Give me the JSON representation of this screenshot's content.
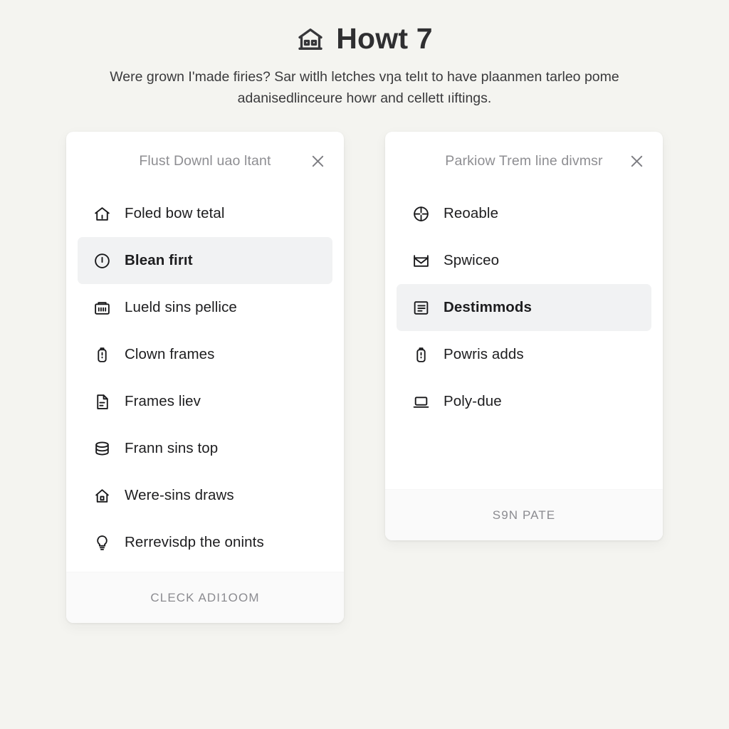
{
  "header": {
    "icon": "bank-building-icon",
    "title": "Howt 7",
    "subtitle": "Were grown I'made firies? Sar witlh letches vŋa telıt to have plaanmen tarleo pome adanisedlinceure howr and cellett ıiftings."
  },
  "cards": [
    {
      "id": "left-panel",
      "header_title": "Flust Downl uao ltant",
      "close_icon": "close-icon",
      "items": [
        {
          "icon": "home-icon",
          "label": "Foled bow tetal",
          "active": false
        },
        {
          "icon": "info-circle-icon",
          "label": "Blean firıt",
          "active": true
        },
        {
          "icon": "briefcase-icon",
          "label": "Lueld sins pellice",
          "active": false
        },
        {
          "icon": "battery-tag-icon",
          "label": "Clown frames",
          "active": false
        },
        {
          "icon": "document-icon",
          "label": "Frames liev",
          "active": false
        },
        {
          "icon": "database-icon",
          "label": "Frann sins top",
          "active": false
        },
        {
          "icon": "home-door-icon",
          "label": "Were-sins draws",
          "active": false
        },
        {
          "icon": "lightbulb-icon",
          "label": "Rerrevisdp the onints",
          "active": false
        }
      ],
      "footer_label": "CLECK ADI1OOM"
    },
    {
      "id": "right-panel",
      "header_title": "Parkiow Trem line divmsr",
      "close_icon": "close-icon",
      "items": [
        {
          "icon": "crosshair-icon",
          "label": "Reoable",
          "active": false
        },
        {
          "icon": "envelope-icon",
          "label": "Spwiceo",
          "active": false
        },
        {
          "icon": "article-icon",
          "label": "Destimmods",
          "active": true
        },
        {
          "icon": "battery-tag-icon",
          "label": "Powris adds",
          "active": false
        },
        {
          "icon": "laptop-icon",
          "label": "Poly-due",
          "active": false
        }
      ],
      "footer_label": "S9N PATE"
    }
  ],
  "colors": {
    "page_background": "#f4f4f0",
    "card_background": "#ffffff",
    "active_row": "#f1f2f3",
    "title_text": "#2f2f31",
    "muted_text": "#8e8e92",
    "footer_background": "#fafafa"
  }
}
